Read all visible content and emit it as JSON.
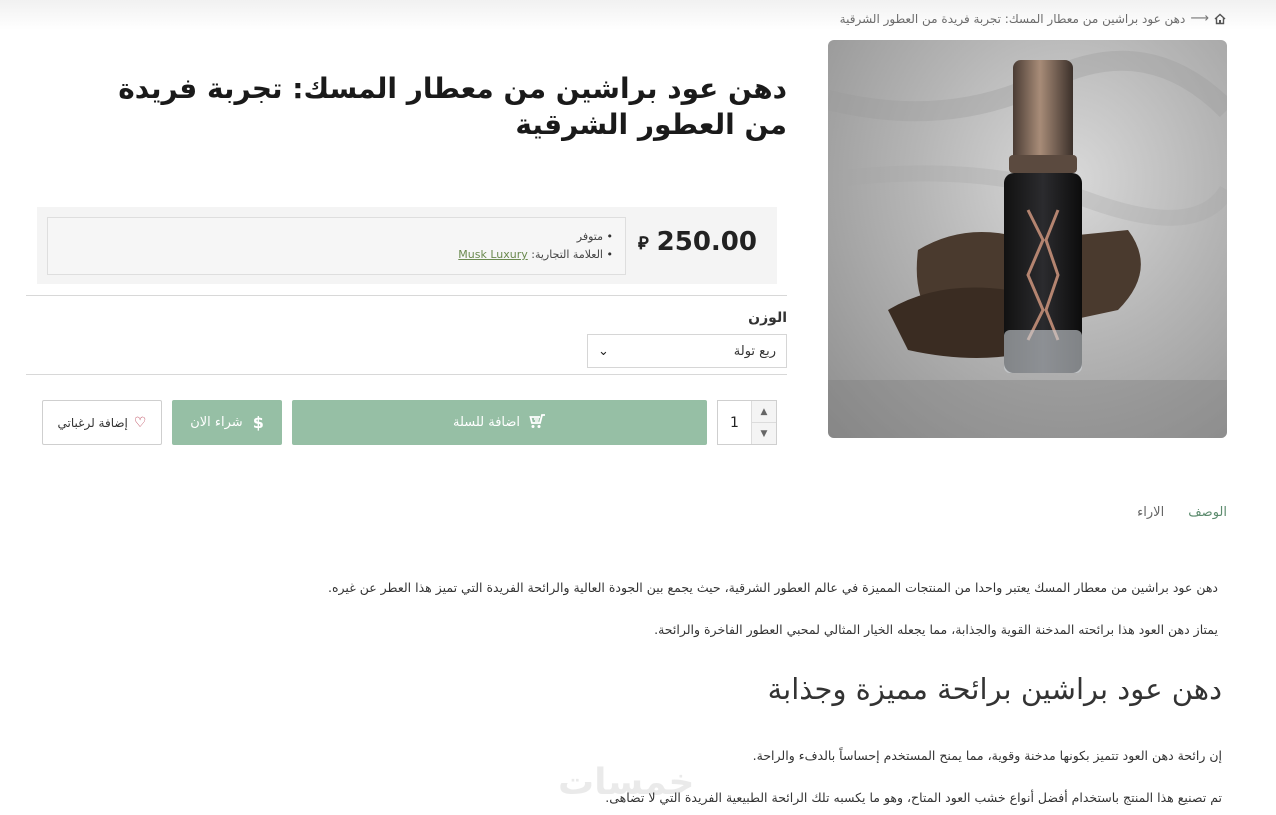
{
  "breadcrumb": {
    "home_icon": "home-icon",
    "arrow": "⟶",
    "current": "دهن عود براشين من معطار المسك: تجربة فريدة من العطور الشرقية"
  },
  "product": {
    "title": "دهن عود براشين من معطار المسك: تجربة فريدة من العطور الشرقية",
    "price": "250.00",
    "currency_icon": "saudi-riyal-icon",
    "availability": "متوفر",
    "brand_label": "العلامة التجارية:",
    "brand_value": "Musk Luxury",
    "image_icon": "perfume-bottle-image"
  },
  "options": {
    "weight_label": "الوزن",
    "weight_selected": "ربع تولة"
  },
  "actions": {
    "quantity": "1",
    "add_to_cart": "اضافة للسلة",
    "buy_now": "شراء الان",
    "wishlist": "إضافة لرغباتي"
  },
  "tabs": [
    {
      "label": "الوصف"
    },
    {
      "label": "الاراء"
    }
  ],
  "description": {
    "p1": "دهن عود براشين من معطار المسك يعتبر واحدا من المنتجات المميزة في عالم العطور الشرقية، حيث يجمع بين الجودة العالية والرائحة الفريدة التي تميز هذا العطر عن غيره.",
    "p2": "يمتاز دهن العود هذا برائحته المدخنة القوية والجذابة، مما يجعله الخيار المثالي لمحبي العطور الفاخرة والرائحة.",
    "heading": "دهن عود براشين برائحة مميزة وجذابة",
    "p3": "إن رائحة دهن العود تتميز بكونها مدخنة وقوية، مما يمنح المستخدم إحساساً بالدفء والراحة.",
    "p4": "تم تصنيع هذا المنتج باستخدام أفضل أنواع خشب العود المتاح، وهو ما يكسبه تلك الرائحة الطبيعية الفريدة التي لا تضاهى."
  },
  "watermark": "خمسات",
  "colors": {
    "accent": "#96bfa5",
    "tab_active": "#5c8b6e",
    "heart": "#b0283e"
  }
}
